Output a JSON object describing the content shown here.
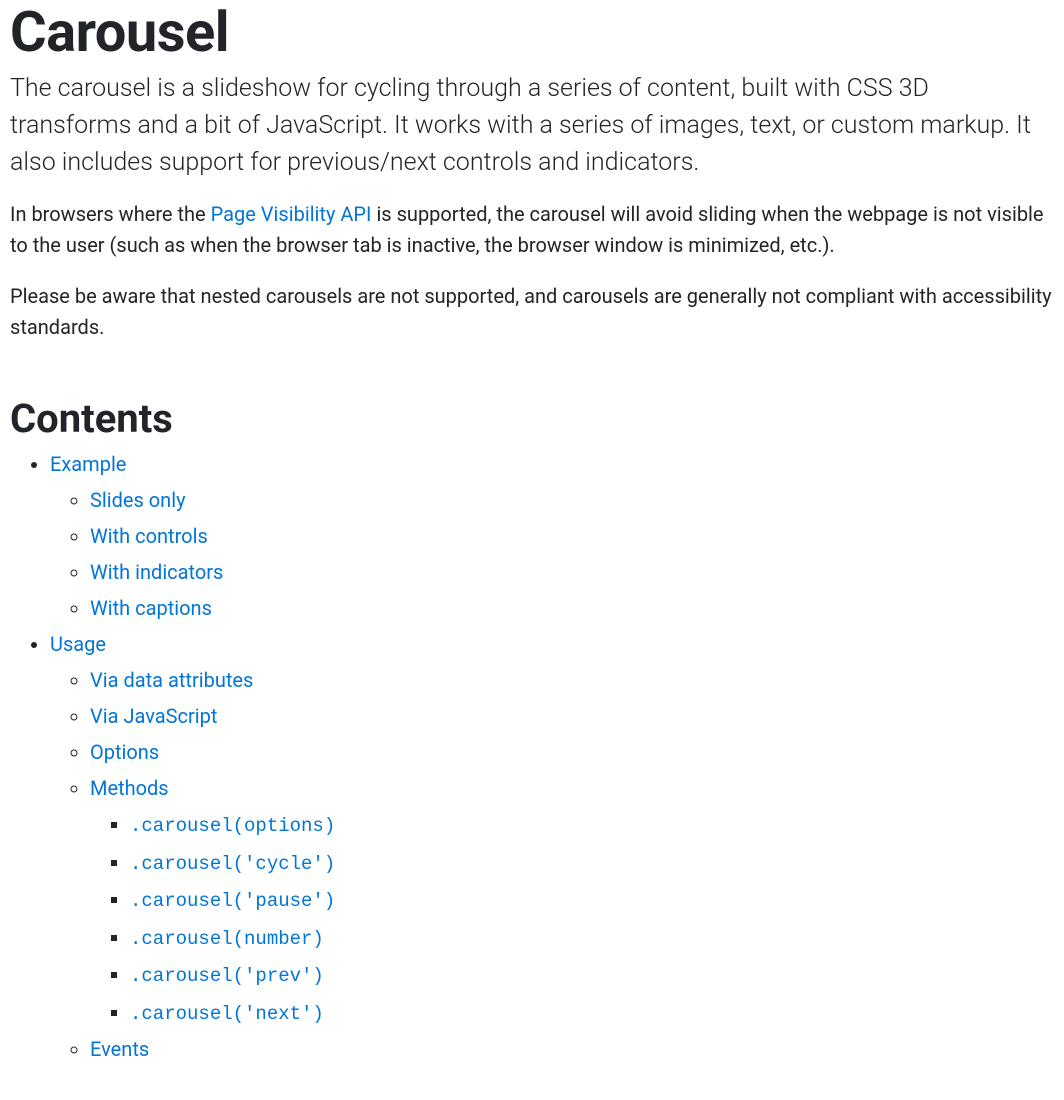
{
  "title": "Carousel",
  "lead": "The carousel is a slideshow for cycling through a series of content, built with CSS 3D transforms and a bit of JavaScript. It works with a series of images, text, or custom markup. It also includes support for previous/next controls and indicators.",
  "para1": {
    "pre": "In browsers where the ",
    "link": "Page Visibility API",
    "post": " is supported, the carousel will avoid sliding when the webpage is not visible to the user (such as when the browser tab is inactive, the browser window is minimized, etc.)."
  },
  "para2": "Please be aware that nested carousels are not supported, and carousels are generally not compliant with accessibility standards.",
  "contents_heading": "Contents",
  "toc": {
    "example": "Example",
    "example_children": {
      "slides_only": "Slides only",
      "with_controls": "With controls",
      "with_indicators": "With indicators",
      "with_captions": "With captions"
    },
    "usage": "Usage",
    "usage_children": {
      "via_data_attributes": "Via data attributes",
      "via_javascript": "Via JavaScript",
      "options": "Options",
      "methods": "Methods",
      "methods_children": {
        "m0": ".carousel(options)",
        "m1": ".carousel('cycle')",
        "m2": ".carousel('pause')",
        "m3": ".carousel(number)",
        "m4": ".carousel('prev')",
        "m5": ".carousel('next')"
      },
      "events": "Events"
    }
  }
}
